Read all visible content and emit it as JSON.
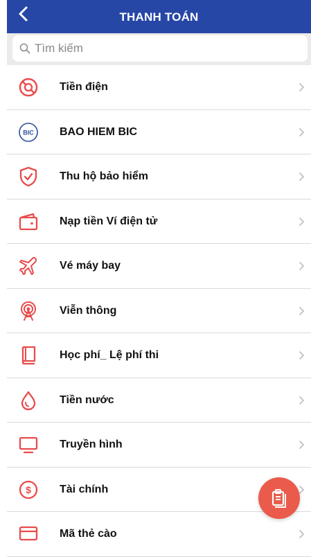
{
  "header": {
    "title": "THANH TOÁN",
    "back_icon": "back-chevron-icon",
    "background": "#2747a7"
  },
  "search": {
    "placeholder": "Tìm kiếm",
    "icon": "search-icon"
  },
  "items": [
    {
      "label": "Tiền điện",
      "icon": "electricity-icon"
    },
    {
      "label": "BAO HIEM BIC",
      "icon": "bic-logo-icon",
      "icon_text": "BIC"
    },
    {
      "label": "Thu hộ bảo hiểm",
      "icon": "shield-check-icon"
    },
    {
      "label": "Nạp tiền Ví điện tử",
      "icon": "wallet-icon"
    },
    {
      "label": "Vé máy bay",
      "icon": "airplane-icon"
    },
    {
      "label": "Viễn thông",
      "icon": "antenna-icon"
    },
    {
      "label": "Học phí_ Lệ phí thi",
      "icon": "book-icon"
    },
    {
      "label": "Tiền nước",
      "icon": "water-drop-icon"
    },
    {
      "label": "Truyền hình",
      "icon": "tv-icon"
    },
    {
      "label": "Tài chính",
      "icon": "dollar-coin-icon"
    },
    {
      "label": "Mã thẻ cào",
      "icon": "card-icon"
    }
  ],
  "fab": {
    "icon": "clipboard-icon",
    "color": "#ea5b4b"
  },
  "colors": {
    "accent_red": "#e94b4b",
    "brand_blue": "#2747a7"
  }
}
